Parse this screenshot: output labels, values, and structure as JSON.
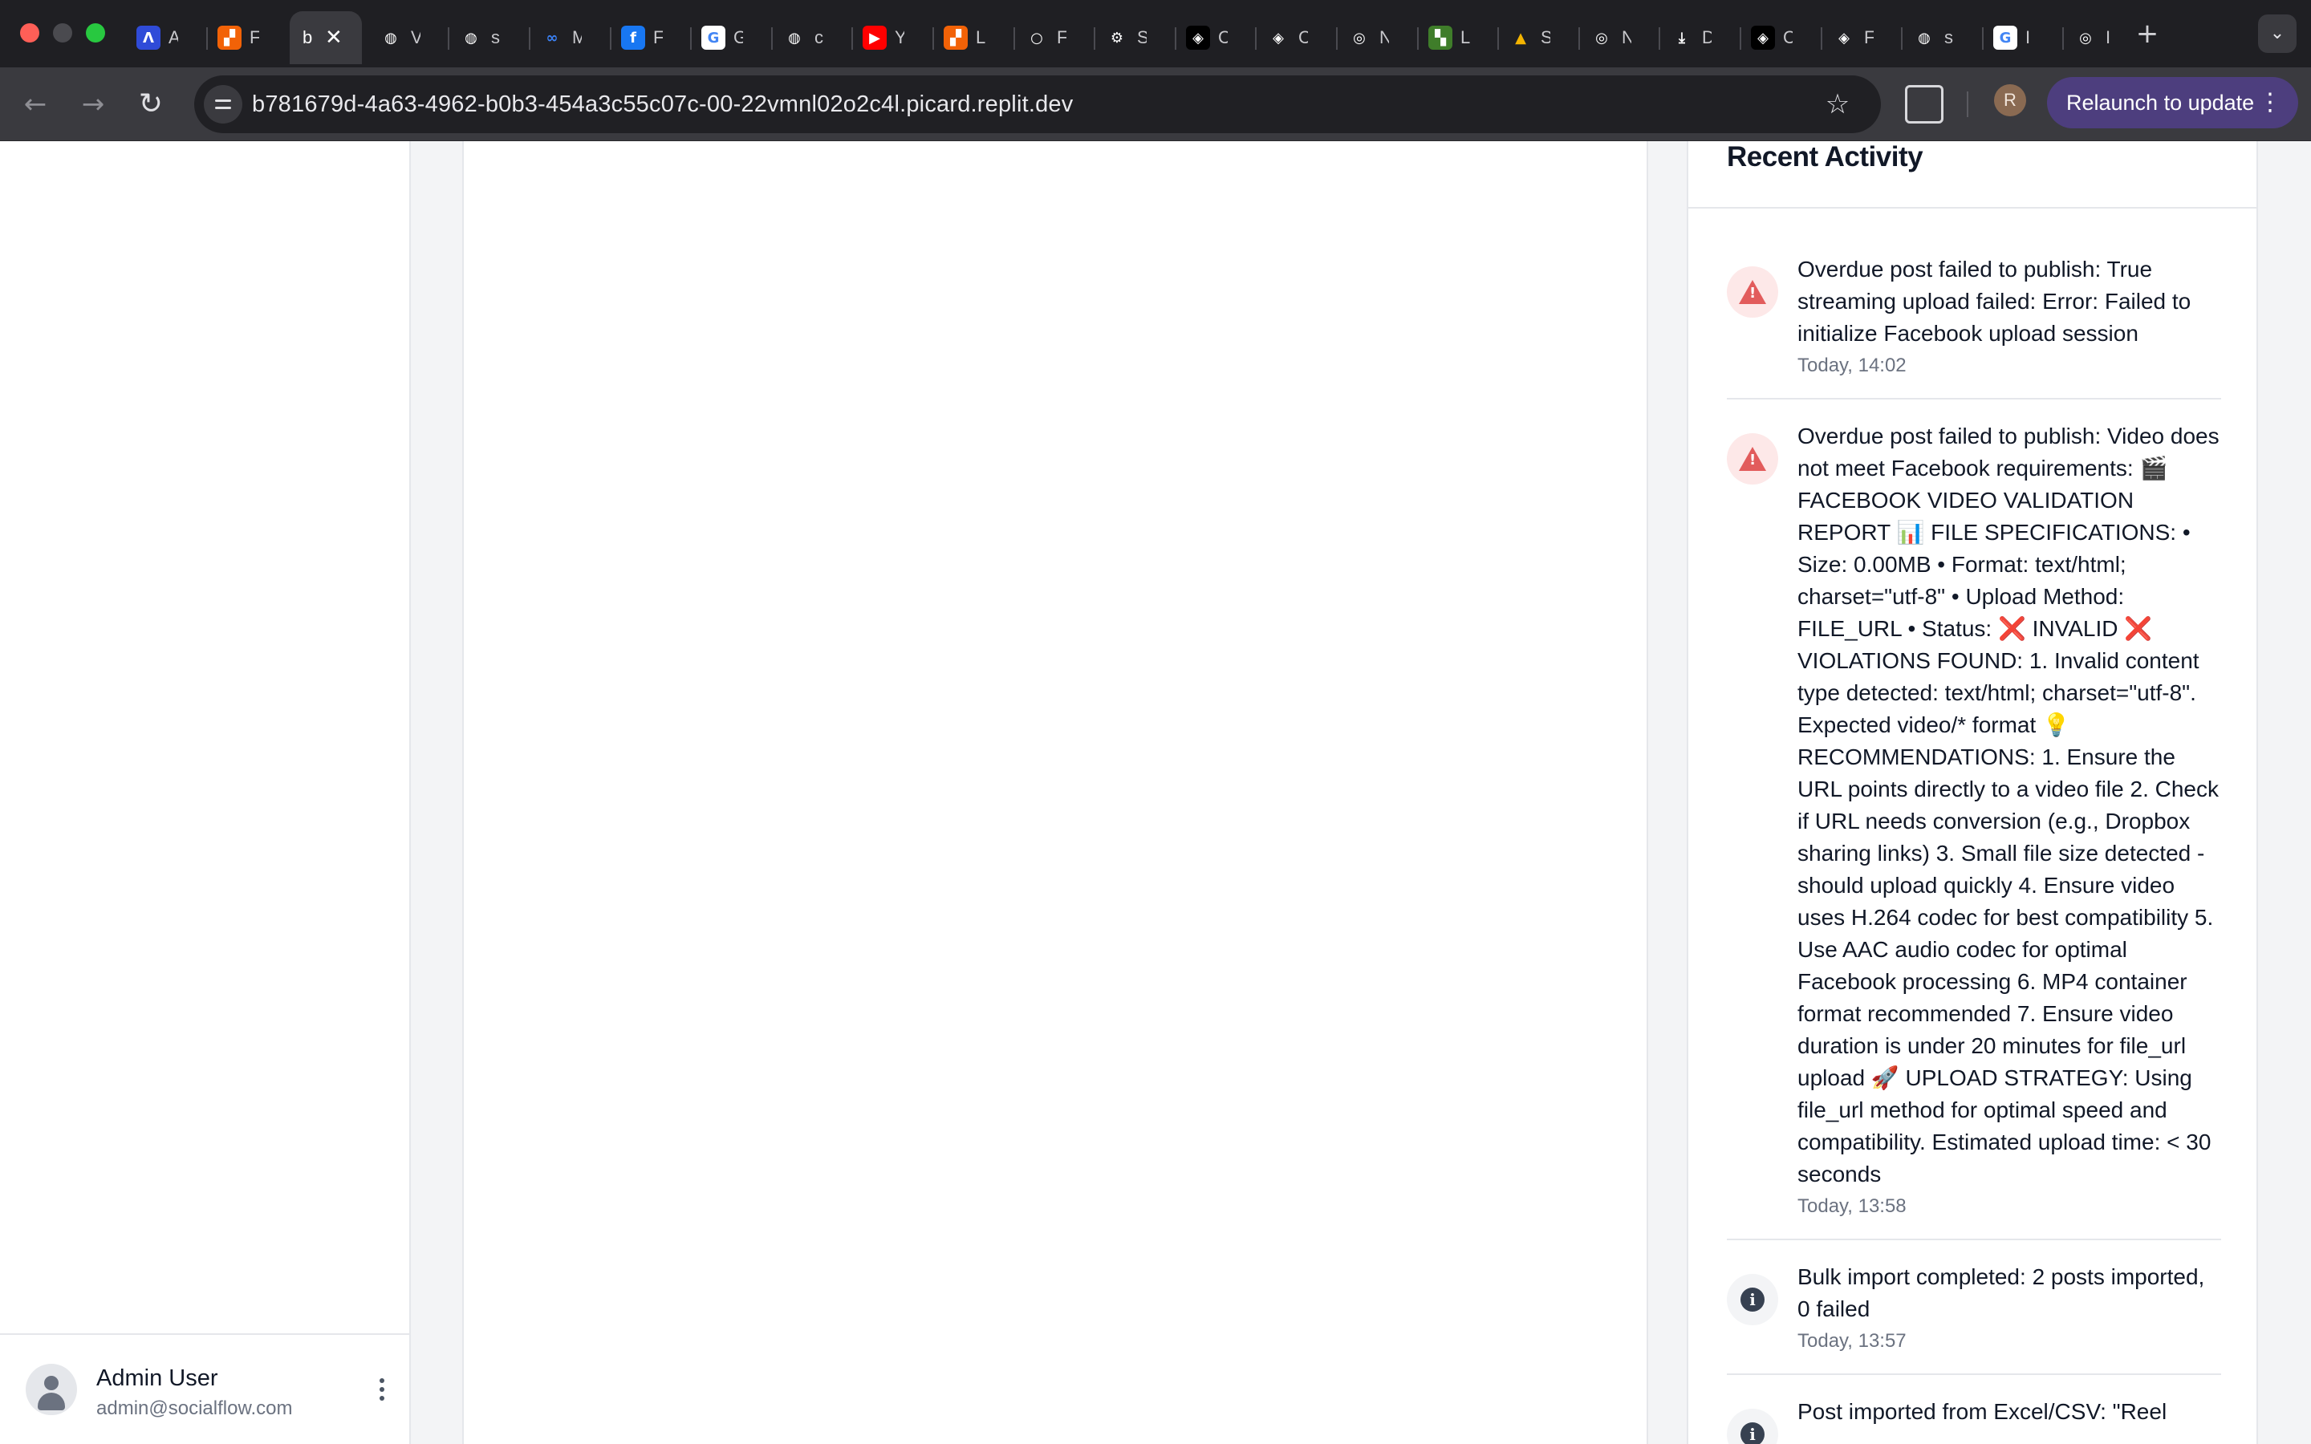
{
  "browser": {
    "tabs": [
      {
        "icon": "anthropic-icon",
        "glyph": "Λ",
        "bg": "#2f4bd8",
        "title": "A"
      },
      {
        "icon": "replit-icon",
        "glyph": "▞",
        "bg": "#f26207",
        "title": "F"
      },
      {
        "icon": "page-icon",
        "glyph": "",
        "bg": "transparent",
        "title": "b",
        "active": true
      },
      {
        "icon": "globe-icon",
        "glyph": "◍",
        "bg": "transparent",
        "title": "V"
      },
      {
        "icon": "globe-icon",
        "glyph": "◍",
        "bg": "transparent",
        "title": "s"
      },
      {
        "icon": "meta-icon",
        "glyph": "∞",
        "bg": "transparent",
        "title": "M"
      },
      {
        "icon": "facebook-icon",
        "glyph": "f",
        "bg": "#1877f2",
        "title": "F"
      },
      {
        "icon": "google-icon",
        "glyph": "G",
        "bg": "#ffffff",
        "title": "G"
      },
      {
        "icon": "globe-icon",
        "glyph": "◍",
        "bg": "transparent",
        "title": "c"
      },
      {
        "icon": "youtube-icon",
        "glyph": "▶",
        "bg": "#ff0000",
        "title": "Y"
      },
      {
        "icon": "replit-icon",
        "glyph": "▞",
        "bg": "#f26207",
        "title": "L"
      },
      {
        "icon": "circle-icon",
        "glyph": "○",
        "bg": "transparent",
        "title": "F"
      },
      {
        "icon": "gear-icon",
        "glyph": "⚙",
        "bg": "transparent",
        "title": "S"
      },
      {
        "icon": "cube-icon",
        "glyph": "◈",
        "bg": "#000000",
        "title": "C"
      },
      {
        "icon": "cube-icon",
        "glyph": "◈",
        "bg": "transparent",
        "title": "C"
      },
      {
        "icon": "chrome-icon",
        "glyph": "◎",
        "bg": "transparent",
        "title": "N"
      },
      {
        "icon": "clapper-icon",
        "glyph": "▚",
        "bg": "#3f7d2a",
        "title": "L"
      },
      {
        "icon": "drive-icon",
        "glyph": "▲",
        "bg": "transparent",
        "title": "S"
      },
      {
        "icon": "chrome-icon",
        "glyph": "◎",
        "bg": "transparent",
        "title": "N"
      },
      {
        "icon": "download-icon",
        "glyph": "⤓",
        "bg": "transparent",
        "title": "D"
      },
      {
        "icon": "cube-icon",
        "glyph": "◈",
        "bg": "#000000",
        "title": "C"
      },
      {
        "icon": "cube-icon",
        "glyph": "◈",
        "bg": "transparent",
        "title": "F"
      },
      {
        "icon": "globe-icon",
        "glyph": "◍",
        "bg": "transparent",
        "title": "s"
      },
      {
        "icon": "google-icon",
        "glyph": "G",
        "bg": "#ffffff",
        "title": "I"
      },
      {
        "icon": "chrome-icon",
        "glyph": "◎",
        "bg": "transparent",
        "title": "I"
      }
    ],
    "url": "b781679d-4a63-4962-b0b3-454a3c55c07c-00-22vmnl02o2c4l.picard.replit.dev",
    "profile_initial": "R",
    "relaunch_label": "Relaunch to update"
  },
  "sidebar": {
    "user": {
      "name": "Admin User",
      "email": "admin@socialflow.com"
    }
  },
  "activity": {
    "title": "Recent Activity",
    "items": [
      {
        "type": "error",
        "message": "Overdue post failed to publish: True streaming upload failed: Error: Failed to initialize Facebook upload session",
        "time": "Today, 14:02"
      },
      {
        "type": "error",
        "message": "Overdue post failed to publish: Video does not meet Facebook requirements: 🎬 FACEBOOK VIDEO VALIDATION REPORT 📊 FILE SPECIFICATIONS: • Size: 0.00MB • Format: text/html; charset=\"utf-8\" • Upload Method: FILE_URL • Status: ❌ INVALID ❌ VIOLATIONS FOUND: 1. Invalid content type detected: text/html; charset=\"utf-8\". Expected video/* format 💡 RECOMMENDATIONS: 1. Ensure the URL points directly to a video file 2. Check if URL needs conversion (e.g., Dropbox sharing links) 3. Small file size detected - should upload quickly 4. Ensure video uses H.264 codec for best compatibility 5. Use AAC audio codec for optimal Facebook processing 6. MP4 container format recommended 7. Ensure video duration is under 20 minutes for file_url upload 🚀 UPLOAD STRATEGY: Using file_url method for optimal speed and compatibility. Estimated upload time: < 30 seconds",
        "time": "Today, 13:58"
      },
      {
        "type": "info",
        "message": "Bulk import completed: 2 posts imported, 0 failed",
        "time": "Today, 13:57"
      },
      {
        "type": "info",
        "message": "Post imported from Excel/CSV: \"Reel",
        "time": ""
      }
    ]
  }
}
